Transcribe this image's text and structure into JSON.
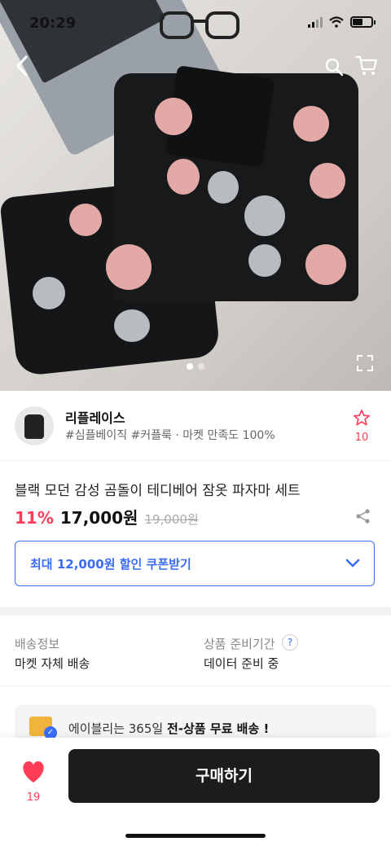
{
  "status_bar": {
    "time": "20:29"
  },
  "store": {
    "name": "리플레이스",
    "tags": "#심플베이직 #커플룩 · 마켓 만족도 100%",
    "favorite_count": "10"
  },
  "product": {
    "title": "블랙 모던 감성 곰돌이 테디베어 잠옷 파자마 세트",
    "discount": "11%",
    "price": "17,000원",
    "original_price": "19,000원"
  },
  "coupon": {
    "label": "최대 12,000원 할인 쿠폰받기"
  },
  "shipping": {
    "delivery_label": "배송정보",
    "delivery_value": "마켓 자체 배송",
    "prep_label": "상품 준비기간",
    "prep_value": "데이터 준비 중",
    "help": "?"
  },
  "promo": {
    "prefix": "에이블리는 365일 ",
    "highlight": "전-상품 무료 배송 !"
  },
  "bottom_bar": {
    "like_count": "19",
    "buy_label": "구매하기"
  },
  "image_pager": {
    "total": 2,
    "current": 1
  },
  "colors": {
    "accent_pink": "#ff3d59",
    "accent_blue": "#3a6cf4",
    "buy_button": "#1c1c1c"
  }
}
